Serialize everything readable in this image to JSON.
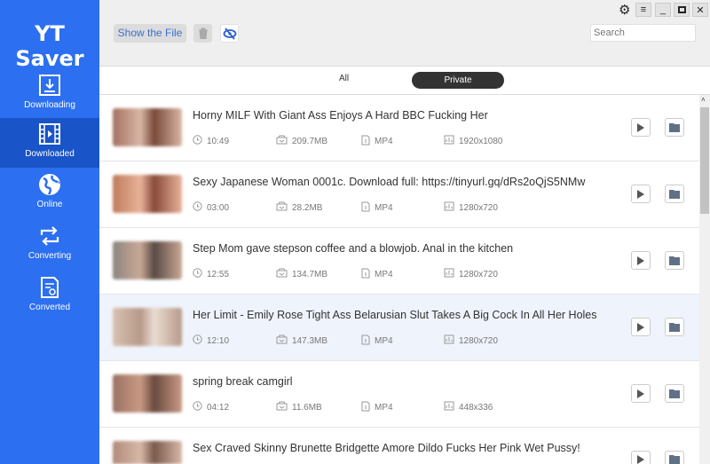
{
  "app": {
    "title": "YT Saver"
  },
  "sidebar": {
    "items": [
      {
        "label": "Downloading",
        "icon": "download-icon"
      },
      {
        "label": "Downloaded",
        "icon": "film-icon",
        "selected": true
      },
      {
        "label": "Online",
        "icon": "globe-icon"
      },
      {
        "label": "Converting",
        "icon": "convert-icon"
      },
      {
        "label": "Converted",
        "icon": "converted-file-icon"
      }
    ]
  },
  "toolbar": {
    "show_file": "Show the File",
    "search_placeholder": "Search"
  },
  "tabs": {
    "all": "All",
    "private": "Private",
    "active": "Private"
  },
  "videos": [
    {
      "title": "Horny MILF With Giant Ass Enjoys A Hard BBC Fucking Her",
      "duration": "10:49",
      "size": "209.7MB",
      "format": "MP4",
      "resolution": "1920x1080",
      "colors": [
        "#a57060",
        "#d9b6a6",
        "#7a4a3a"
      ]
    },
    {
      "title": "Sexy Japanese Woman 0001c. Download full: https://tinyurl.gq/dRs2oQjS5NMw",
      "duration": "03:00",
      "size": "28.2MB",
      "format": "MP4",
      "resolution": "1280x720",
      "colors": [
        "#c07a5a",
        "#e8b39a",
        "#8a4a3a"
      ]
    },
    {
      "title": "Step Mom gave stepson coffee and a blowjob. Anal in the kitchen",
      "duration": "12:55",
      "size": "134.7MB",
      "format": "MP4",
      "resolution": "1280x720",
      "colors": [
        "#8a8580",
        "#c9a996",
        "#5a4a44"
      ]
    },
    {
      "title": "Her Limit - Emily Rose Tight Ass Belarusian Slut Takes A Big Cock In All Her Holes",
      "duration": "12:10",
      "size": "147.3MB",
      "format": "MP4",
      "resolution": "1280x720",
      "colors": [
        "#d8c2b2",
        "#b89a88",
        "#e9dcd2"
      ]
    },
    {
      "title": "spring break camgirl",
      "duration": "04:12",
      "size": "11.6MB",
      "format": "MP4",
      "resolution": "448x336",
      "colors": [
        "#9a7060",
        "#c99a84",
        "#6a4a40"
      ]
    },
    {
      "title": "Sex Craved Skinny Brunette Bridgette Amore Dildo Fucks Her Pink Wet Pussy!",
      "duration": "",
      "size": "",
      "format": "",
      "resolution": "",
      "colors": [
        "#b08a7a",
        "#d8b8a8",
        "#7a5a4a"
      ]
    }
  ]
}
